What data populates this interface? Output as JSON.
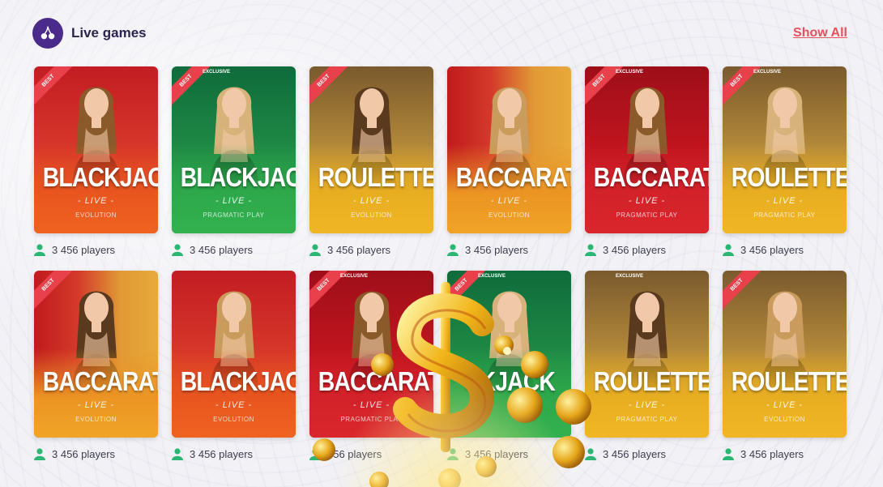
{
  "header": {
    "title": "Live games",
    "show_all": "Show All"
  },
  "colors": {
    "accent": "#e8505b",
    "logo_bg": "#4a2a8a",
    "badge": "#e8414b",
    "players_icon": "#2bb673"
  },
  "games": [
    {
      "name": "BLACKJACK",
      "live": "- LIVE -",
      "provider": "EVOLUTION",
      "badge": "BEST",
      "exclusive": "",
      "theme": "red",
      "players": "3 456 players"
    },
    {
      "name": "BLACKJACK",
      "live": "- LIVE -",
      "provider": "PRAGMATIC PLAY",
      "badge": "BEST",
      "exclusive": "EXCLUSIVE",
      "theme": "green",
      "players": "3 456 players"
    },
    {
      "name": "ROULETTE",
      "live": "- LIVE -",
      "provider": "EVOLUTION",
      "badge": "BEST",
      "exclusive": "",
      "theme": "gold",
      "players": "3 456 players"
    },
    {
      "name": "BACCARAT",
      "live": "- LIVE -",
      "provider": "EVOLUTION",
      "badge": "",
      "exclusive": "",
      "theme": "goldred",
      "players": "3 456 players"
    },
    {
      "name": "BACCARAT",
      "live": "- LIVE -",
      "provider": "PRAGMATIC PLAY",
      "badge": "BEST",
      "exclusive": "EXCLUSIVE",
      "theme": "crimson",
      "players": "3 456 players"
    },
    {
      "name": "ROULETTE",
      "live": "- LIVE -",
      "provider": "PRAGMATIC PLAY",
      "badge": "BEST",
      "exclusive": "EXCLUSIVE",
      "theme": "gold",
      "players": "3 456 players"
    },
    {
      "name": "BACCARAT",
      "live": "- LIVE -",
      "provider": "EVOLUTION",
      "badge": "BEST",
      "exclusive": "",
      "theme": "goldred",
      "players": "3 456 players"
    },
    {
      "name": "BLACKJACK",
      "live": "- LIVE -",
      "provider": "EVOLUTION",
      "badge": "",
      "exclusive": "",
      "theme": "red",
      "players": "3 456 players"
    },
    {
      "name": "BACCARAT",
      "live": "- LIVE -",
      "provider": "PRAGMATIC PLAY",
      "badge": "BEST",
      "exclusive": "EXCLUSIVE",
      "theme": "crimson",
      "players": "456 players"
    },
    {
      "name": "CKJACK",
      "live": "",
      "provider": "",
      "badge": "BEST",
      "exclusive": "EXCLUSIVE",
      "theme": "green",
      "players": "3 456 players"
    },
    {
      "name": "ROULETTE",
      "live": "- LIVE -",
      "provider": "PRAGMATIC PLAY",
      "badge": "",
      "exclusive": "EXCLUSIVE",
      "theme": "gold",
      "players": "3 456 players"
    },
    {
      "name": "ROULETTE",
      "live": "- LIVE -",
      "provider": "EVOLUTION",
      "badge": "BEST",
      "exclusive": "",
      "theme": "gold",
      "players": "3 456 players"
    }
  ]
}
